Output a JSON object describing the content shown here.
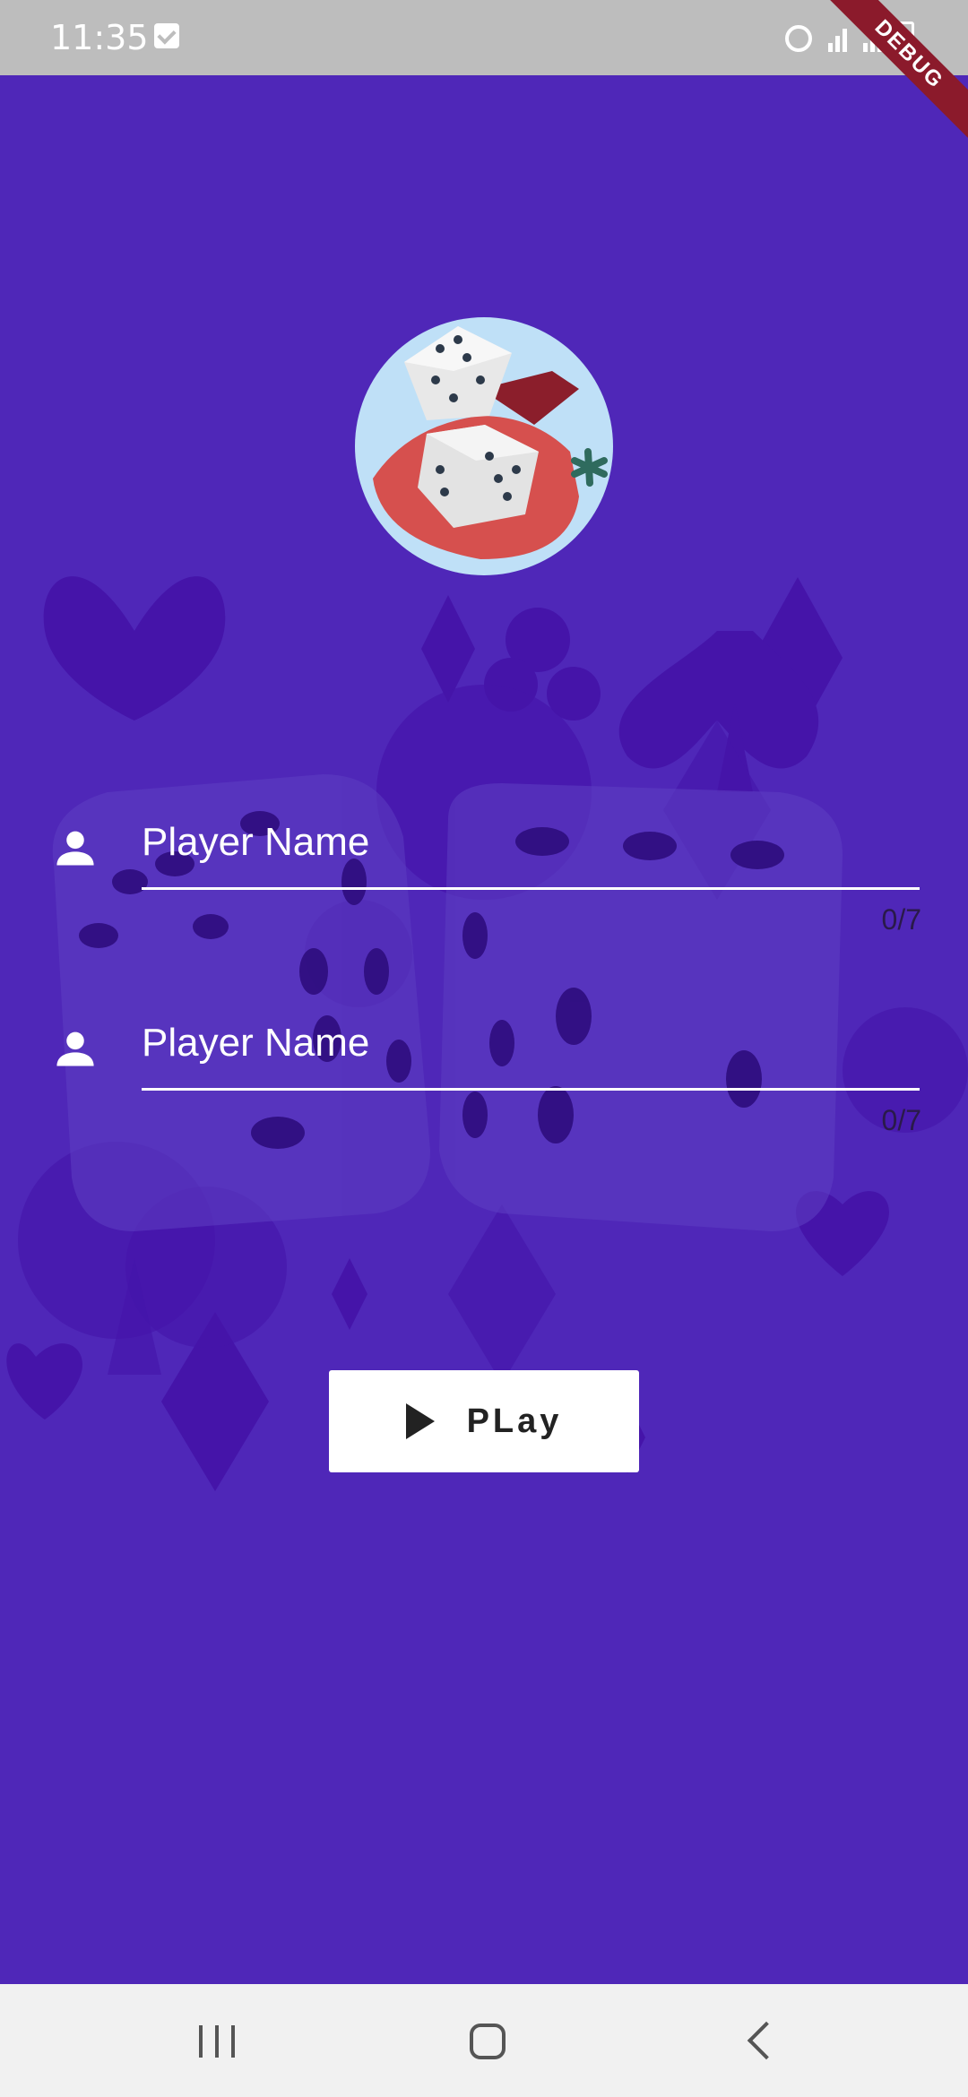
{
  "status_bar": {
    "time": "11:35"
  },
  "debug_banner": "DEBUG",
  "players": [
    {
      "placeholder": "Player Name",
      "counter": "0/7"
    },
    {
      "placeholder": "Player Name",
      "counter": "0/7"
    }
  ],
  "play_button": {
    "label": "PLay",
    "icon": "play-icon"
  },
  "colors": {
    "background": "#4f27b8",
    "status_bar": "#bdbdbd",
    "nav_bar": "#f1f1f1",
    "button": "#ffffff"
  },
  "nav": {
    "recents_icon": "recents-icon",
    "home_icon": "home-icon",
    "back_icon": "back-icon"
  }
}
